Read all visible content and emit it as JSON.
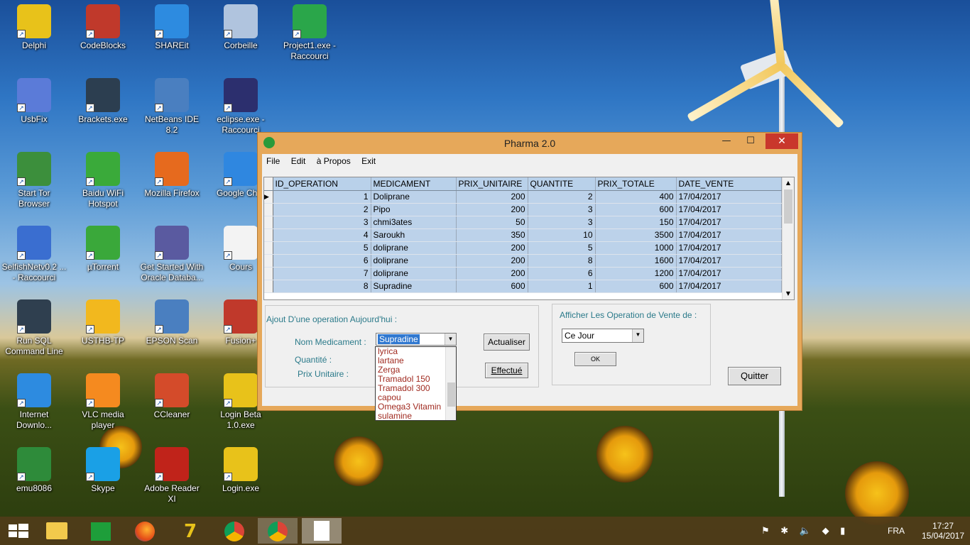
{
  "desktop": {
    "icons": [
      {
        "label": "Delphi"
      },
      {
        "label": "CodeBlocks"
      },
      {
        "label": "SHAREit"
      },
      {
        "label": "Corbeille"
      },
      {
        "label": "Project1.exe - Raccourci"
      },
      {
        "label": "UsbFix"
      },
      {
        "label": "Brackets.exe"
      },
      {
        "label": "NetBeans IDE 8.2"
      },
      {
        "label": "eclipse.exe - Raccourci"
      },
      {
        "label": "Start Tor Browser"
      },
      {
        "label": "Baidu WiFi Hotspot"
      },
      {
        "label": "Mozilla Firefox"
      },
      {
        "label": "Google Chro"
      },
      {
        "label": "SelfishNetv0.2 ... - Raccourci"
      },
      {
        "label": "µTorrent"
      },
      {
        "label": "Get Started With Oracle Databa..."
      },
      {
        "label": "Cours"
      },
      {
        "label": "Run SQL Command Line"
      },
      {
        "label": "USTHB-TP"
      },
      {
        "label": "EPSON Scan"
      },
      {
        "label": "Fusion+"
      },
      {
        "label": "Internet Downlo..."
      },
      {
        "label": "VLC media player"
      },
      {
        "label": "CCleaner"
      },
      {
        "label": "Login Beta 1.0.exe"
      },
      {
        "label": "emu8086"
      },
      {
        "label": "Skype"
      },
      {
        "label": "Adobe Reader XI"
      },
      {
        "label": "Login.exe"
      }
    ]
  },
  "window": {
    "title": "Pharma 2.0",
    "minimize": "—",
    "maximize": "☐",
    "close": "✕",
    "menu": [
      "File",
      "Edit",
      "à Propos",
      "Exit"
    ]
  },
  "grid": {
    "columns": [
      "ID_OPERATION",
      "MEDICAMENT",
      "PRIX_UNITAIRE",
      "QUANTITE",
      "PRIX_TOTALE",
      "DATE_VENTE"
    ],
    "rows": [
      [
        "1",
        "Doliprane",
        "200",
        "2",
        "400",
        "17/04/2017"
      ],
      [
        "2",
        "Pipo",
        "200",
        "3",
        "600",
        "17/04/2017"
      ],
      [
        "3",
        "chmi3ates",
        "50",
        "3",
        "150",
        "17/04/2017"
      ],
      [
        "4",
        "Saroukh",
        "350",
        "10",
        "3500",
        "17/04/2017"
      ],
      [
        "5",
        "doliprane",
        "200",
        "5",
        "1000",
        "17/04/2017"
      ],
      [
        "6",
        "doliprane",
        "200",
        "8",
        "1600",
        "17/04/2017"
      ],
      [
        "7",
        "doliprane",
        "200",
        "6",
        "1200",
        "17/04/2017"
      ],
      [
        "8",
        "Supradine",
        "600",
        "1",
        "600",
        "17/04/2017"
      ]
    ]
  },
  "add_group": {
    "title": "Ajout D'une operation Aujourd'hui :",
    "medicament_label": "Nom Medicament :",
    "quantite_label": "Quantité :",
    "prix_label": "Prix Unitaire :",
    "selected": "Supradine",
    "refresh_button": "Actualiser",
    "submit_button": "Effectué",
    "options": [
      "lyrica",
      "lartane",
      "Zerga",
      "Tramadol 150",
      "Tramadol 300",
      "capou",
      "Omega3 Vitamin",
      "sulamine"
    ]
  },
  "filter_group": {
    "title": "Afficher Les Operation de Vente de :",
    "selected": "Ce Jour",
    "ok_button": "OK"
  },
  "quit_button": "Quitter",
  "taskbar": {
    "language": "FRA",
    "time": "17:27",
    "date": "15/04/2017"
  },
  "colors": {
    "window_frame": "#e6a85a",
    "grid_row": "#bcd2ea",
    "label_teal": "#2b7a8a",
    "close_red": "#c9372c"
  }
}
